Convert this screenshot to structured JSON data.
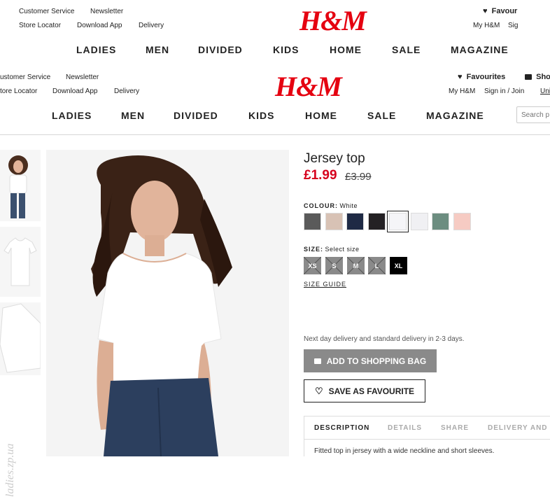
{
  "header_top": {
    "util_links": [
      "Customer Service",
      "Newsletter",
      "Store Locator",
      "Download App",
      "Delivery"
    ],
    "logo": "H&M",
    "favourites": "Favour",
    "account": "My H&M",
    "signin": "Sig",
    "nav": [
      "LADIES",
      "MEN",
      "DIVIDED",
      "KIDS",
      "HOME",
      "SALE",
      "MAGAZINE"
    ]
  },
  "header": {
    "util_links": [
      "ustomer Service",
      "Newsletter",
      "tore Locator",
      "Download App",
      "Delivery"
    ],
    "logo": "H&M",
    "favourites": "Favourites",
    "bag": "Sho",
    "account": "My H&M",
    "signin": "Sign in / Join",
    "uni": "Uni",
    "nav": [
      "LADIES",
      "MEN",
      "DIVIDED",
      "KIDS",
      "HOME",
      "SALE",
      "MAGAZINE"
    ],
    "search_placeholder": "Search p"
  },
  "product": {
    "title": "Jersey top",
    "price": "£1.99",
    "old_price": "£3.99",
    "colour_label": "COLOUR:",
    "colour_value": "White",
    "swatches": [
      "#5a5a5a",
      "#d8c2b5",
      "#1f2a45",
      "#242124",
      "#f5f5f8",
      "#f0f0f3",
      "#6c8d80",
      "#f6cbc3"
    ],
    "selected_swatch": 4,
    "size_label": "SIZE:",
    "size_value": "Select size",
    "sizes": [
      "XS",
      "S",
      "M",
      "L",
      "XL"
    ],
    "size_guide": "SIZE GUIDE",
    "delivery_note": "Next day delivery and standard delivery in 2-3 days.",
    "add_to_bag": "ADD TO SHOPPING BAG",
    "save_favourite": "SAVE AS FAVOURITE",
    "tabs": [
      "DESCRIPTION",
      "DETAILS",
      "SHARE",
      "DELIVERY AND P"
    ],
    "description": "Fitted top in jersey with a wide neckline and short sleeves."
  },
  "watermark": "ladies.zp.ua",
  "colors": {
    "brand_red": "#e50010",
    "price_red": "#d6001c"
  }
}
